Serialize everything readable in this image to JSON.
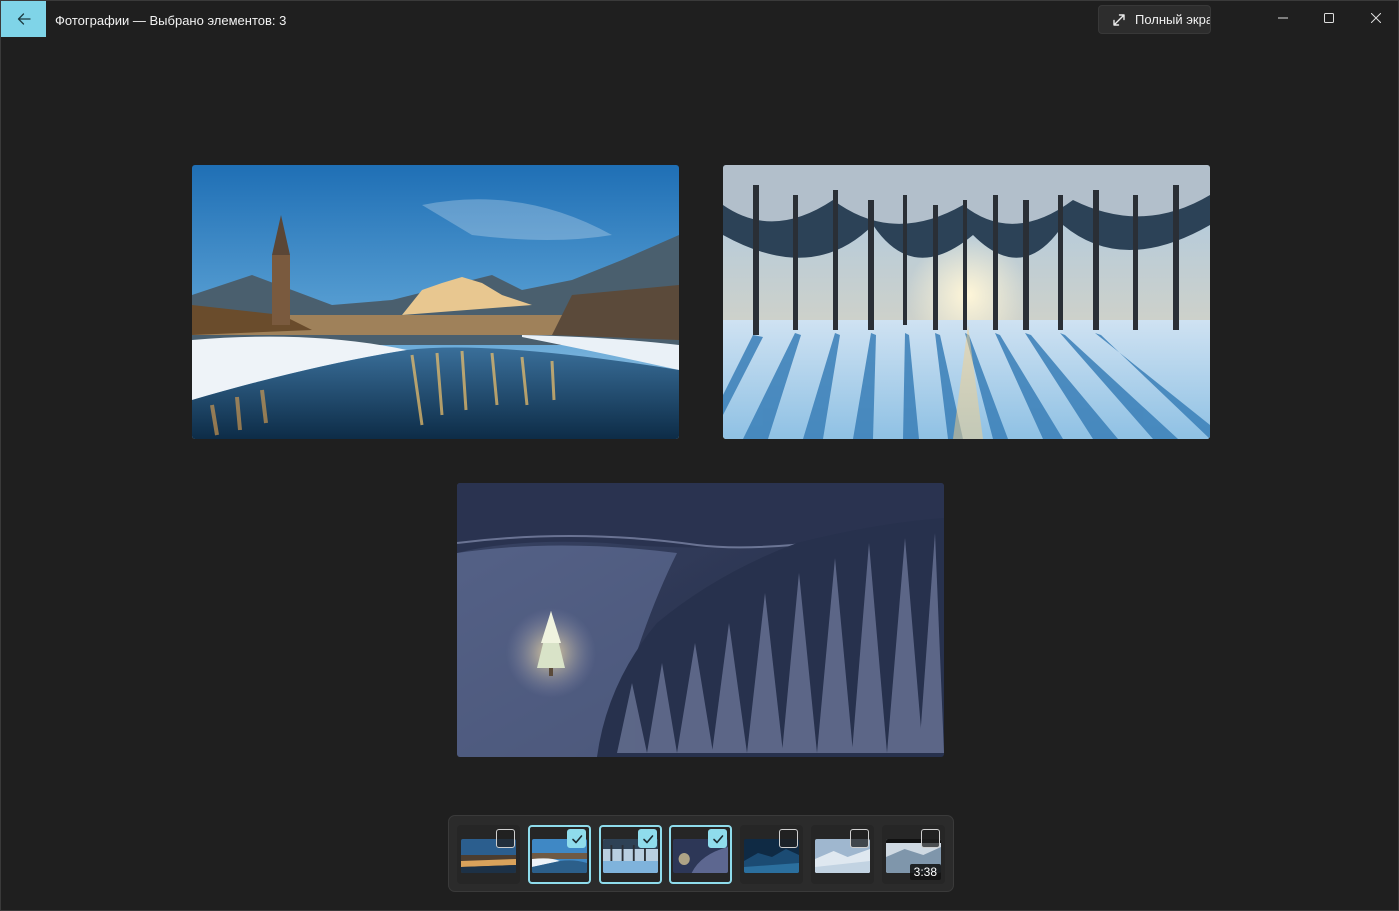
{
  "window": {
    "title": "Фотографии — Выбрано элементов: 3",
    "fullscreen_label": "Полный экран",
    "accent_color": "#7fd4e8"
  },
  "photos": [
    {
      "name": "salzburg-river-winter"
    },
    {
      "name": "snowy-forest-sunset"
    },
    {
      "name": "forest-christmas-tree-aerial"
    }
  ],
  "filmstrip": {
    "items": [
      {
        "selected": false,
        "type": "photo"
      },
      {
        "selected": true,
        "type": "photo"
      },
      {
        "selected": true,
        "type": "photo"
      },
      {
        "selected": true,
        "type": "photo"
      },
      {
        "selected": false,
        "type": "photo"
      },
      {
        "selected": false,
        "type": "photo"
      },
      {
        "selected": false,
        "type": "video",
        "duration": "3:38"
      }
    ]
  }
}
